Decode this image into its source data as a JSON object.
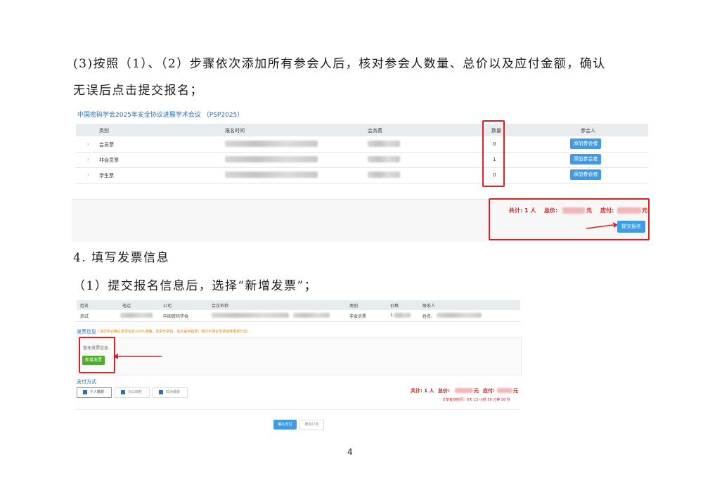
{
  "step3_text": {
    "line1": "(3)按照（1）、（2）步骤依次添加所有参会人后，核对参会人数量、总价以及应付金额，确认",
    "line2": "无误后点击提交报名；"
  },
  "registration_screenshot": {
    "conference_title": "中国密码学会2025年安全协议进展学术会议 （PSP2025）",
    "columns": [
      "类别",
      "报名时间",
      "会务费",
      "数量",
      "参会人"
    ],
    "rows": [
      {
        "category": "会员票",
        "quantity": "0",
        "action": "添加参会者"
      },
      {
        "category": "非会员票",
        "quantity": "1",
        "action": "添加参会者"
      },
      {
        "category": "学生票",
        "quantity": "0",
        "action": "添加参会者"
      }
    ],
    "total_label": "共计: 1 人",
    "total_price_label": "总价:",
    "currency": "元",
    "payable_label": "应付:",
    "submit_label": "提交报名"
  },
  "section4_heading": "4. 填写发票信息",
  "step1_text": "（1）提交报名信息后，选择“新增发票”；",
  "invoice_screenshot": {
    "columns": [
      "姓名",
      "电话",
      "公司",
      "会议名称",
      "类别",
      "价格",
      "联系人"
    ],
    "row": {
      "name": "测试",
      "company": "中国密码学会",
      "category": "非会员票",
      "price_prefix": "1",
      "contact_prefix": "姓名:"
    },
    "invoice_label": "发票信息",
    "invoice_note": "（请您务必确认发票信息100%准确。发票开票后，信息提供错误，我们不保证发票能够重新开具）",
    "no_invoice_text": "暂无发票信息",
    "add_invoice_label": "新增发票",
    "payment_label": "支付方式",
    "payment_options": [
      "个人缴费",
      "对公转账",
      "现场缴费"
    ],
    "total_label": "共计: 1 人",
    "total_price_label": "总价:",
    "currency": "元",
    "payable_label": "应付:",
    "countdown": "订单有效时间：0天 23 小时 59 分钟 58 秒",
    "confirm_label": "确认支付",
    "cancel_label": "取消订单"
  },
  "page_number": "4",
  "colors": {
    "accent_blue": "#3d9be9",
    "highlight_red": "#e02020",
    "add_green": "#4caf2a",
    "title_blue": "#2a6ebd"
  }
}
